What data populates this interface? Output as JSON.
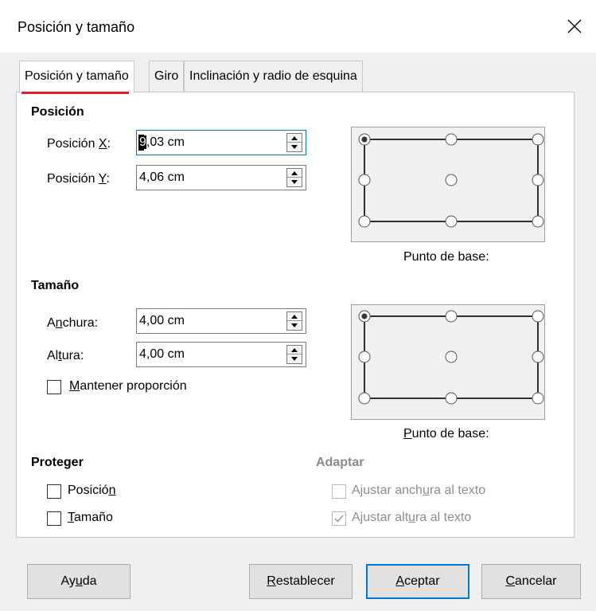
{
  "window": {
    "title": "Posición y tamaño"
  },
  "tabs": [
    {
      "label": "Posición y tamaño"
    },
    {
      "label": "Giro"
    },
    {
      "label": "Inclinación y radio de esquina"
    }
  ],
  "position": {
    "heading": "Posición",
    "x": {
      "label_pre": "Posición ",
      "label_key": "X",
      "label_post": ":",
      "value": ",03 cm",
      "value_first": "9"
    },
    "y": {
      "label_pre": "Posición ",
      "label_key": "Y",
      "label_post": ":",
      "value": "4,06 cm"
    },
    "base_point_label": "Punto de base:"
  },
  "size": {
    "heading": "Tamaño",
    "width": {
      "label_pre": "A",
      "label_key": "n",
      "label_post": "chura:",
      "value": "4,00 cm"
    },
    "height": {
      "label_pre": "Al",
      "label_key": "t",
      "label_post": "ura:",
      "value": "4,00 cm"
    },
    "keep_ratio": {
      "label_key": "M",
      "label_post": "antener proporción",
      "checked": false
    },
    "base_point_label_key": "P",
    "base_point_label_post": "unto de base:"
  },
  "protect": {
    "heading": "Proteger",
    "position": {
      "label_pre": "Posició",
      "label_key": "n",
      "checked": false
    },
    "size": {
      "label_key": "T",
      "label_post": "amaño",
      "checked": false
    }
  },
  "adapt": {
    "heading": "Adaptar",
    "fit_width": {
      "label_pre": "Ajustar anch",
      "label_key": "u",
      "label_post": "ra al texto",
      "checked": false
    },
    "fit_height": {
      "label_pre": "Ajustar alt",
      "label_key": "u",
      "label_post": "ra al texto",
      "checked": true
    }
  },
  "buttons": {
    "help": {
      "pre": "Ay",
      "key": "u",
      "post": "da"
    },
    "reset": {
      "key": "R",
      "post": "establecer"
    },
    "ok": {
      "key": "A",
      "post": "ceptar"
    },
    "cancel": {
      "key": "C",
      "post": "ancelar"
    }
  },
  "colors": {
    "accent": "#0078d7",
    "tab_underline": "#e2202b"
  }
}
